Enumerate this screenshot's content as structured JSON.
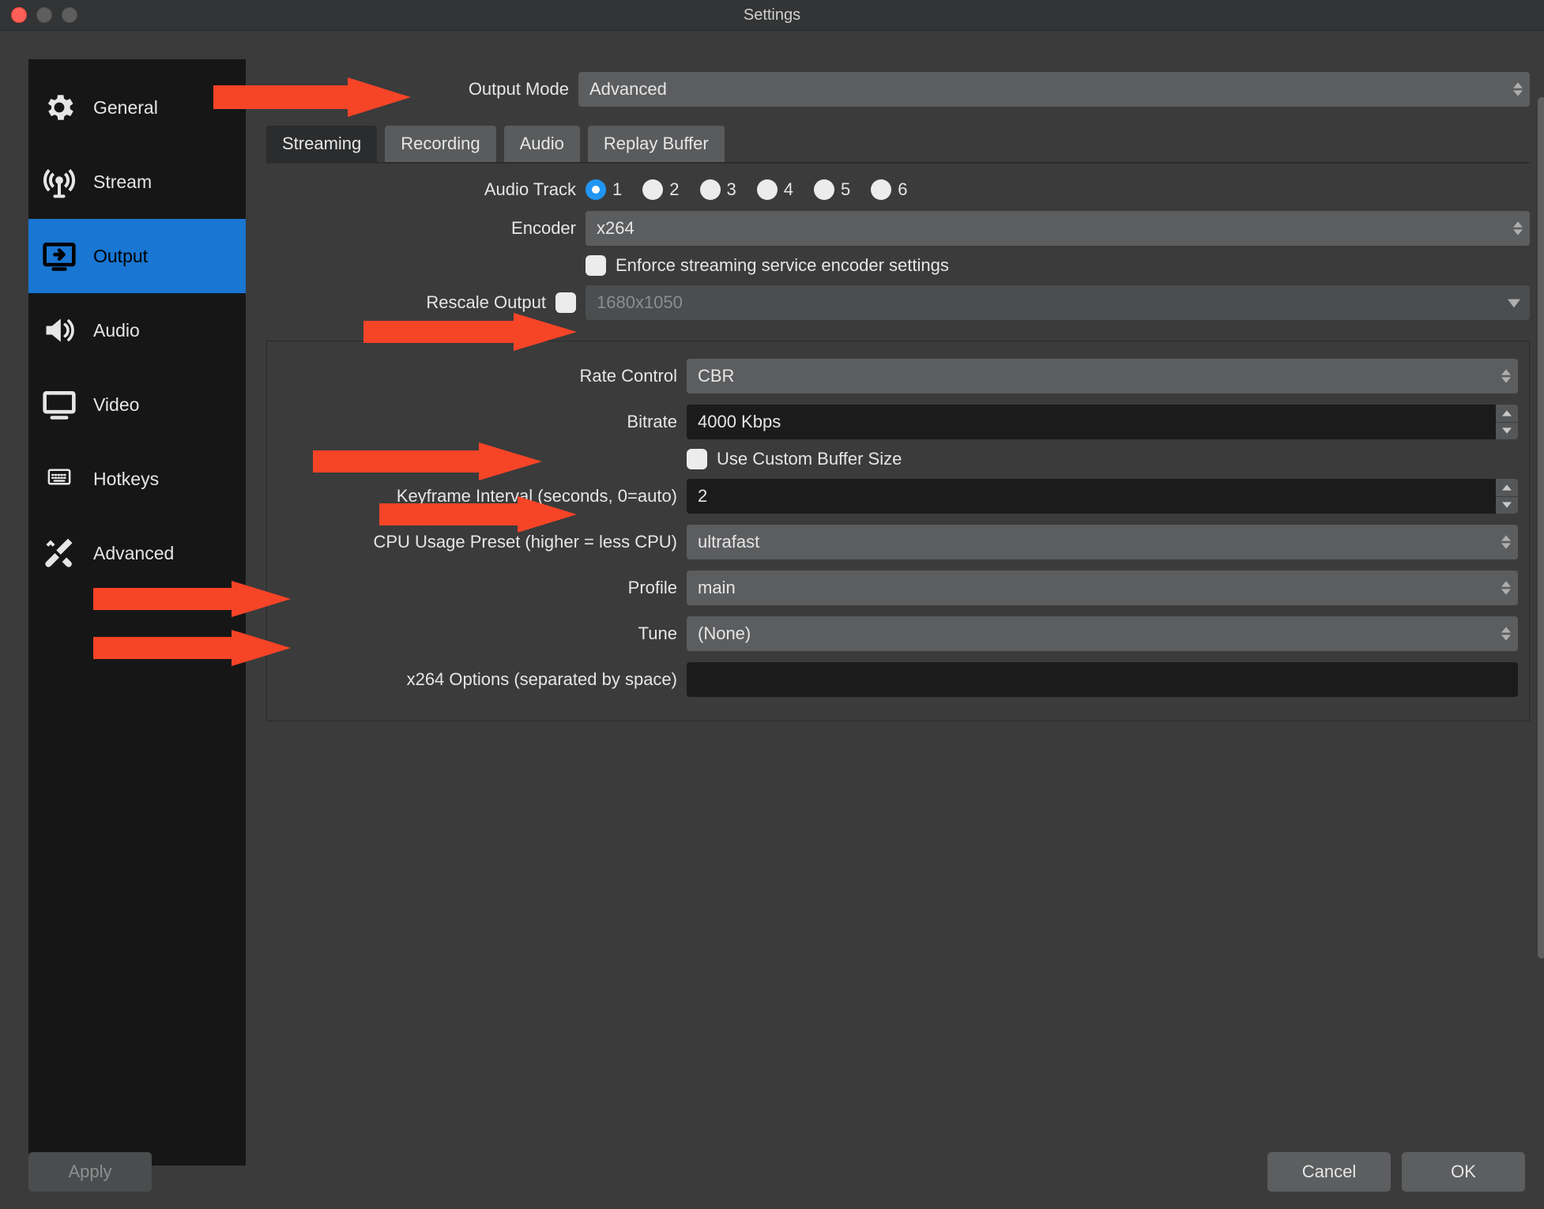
{
  "windowTitle": "Settings",
  "sidebar": {
    "items": [
      {
        "label": "General"
      },
      {
        "label": "Stream"
      },
      {
        "label": "Output"
      },
      {
        "label": "Audio"
      },
      {
        "label": "Video"
      },
      {
        "label": "Hotkeys"
      },
      {
        "label": "Advanced"
      }
    ],
    "selectedIndex": 2
  },
  "outputMode": {
    "label": "Output Mode",
    "value": "Advanced"
  },
  "tabs": [
    "Streaming",
    "Recording",
    "Audio",
    "Replay Buffer"
  ],
  "activeTabIndex": 0,
  "audioTrack": {
    "label": "Audio Track",
    "options": [
      "1",
      "2",
      "3",
      "4",
      "5",
      "6"
    ],
    "selected": "1"
  },
  "encoder": {
    "label": "Encoder",
    "value": "x264"
  },
  "enforce": {
    "label": "Enforce streaming service encoder settings",
    "checked": false
  },
  "rescale": {
    "label": "Rescale Output",
    "checked": false,
    "placeholder": "1680x1050"
  },
  "rateControl": {
    "label": "Rate Control",
    "value": "CBR"
  },
  "bitrate": {
    "label": "Bitrate",
    "value": "4000 Kbps"
  },
  "customBuffer": {
    "label": "Use Custom Buffer Size",
    "checked": false
  },
  "keyframe": {
    "label": "Keyframe Interval (seconds, 0=auto)",
    "value": "2"
  },
  "cpuPreset": {
    "label": "CPU Usage Preset (higher = less CPU)",
    "value": "ultrafast"
  },
  "profile": {
    "label": "Profile",
    "value": "main"
  },
  "tune": {
    "label": "Tune",
    "value": "(None)"
  },
  "x264opts": {
    "label": "x264 Options (separated by space)",
    "value": ""
  },
  "buttons": {
    "apply": "Apply",
    "cancel": "Cancel",
    "ok": "OK"
  }
}
